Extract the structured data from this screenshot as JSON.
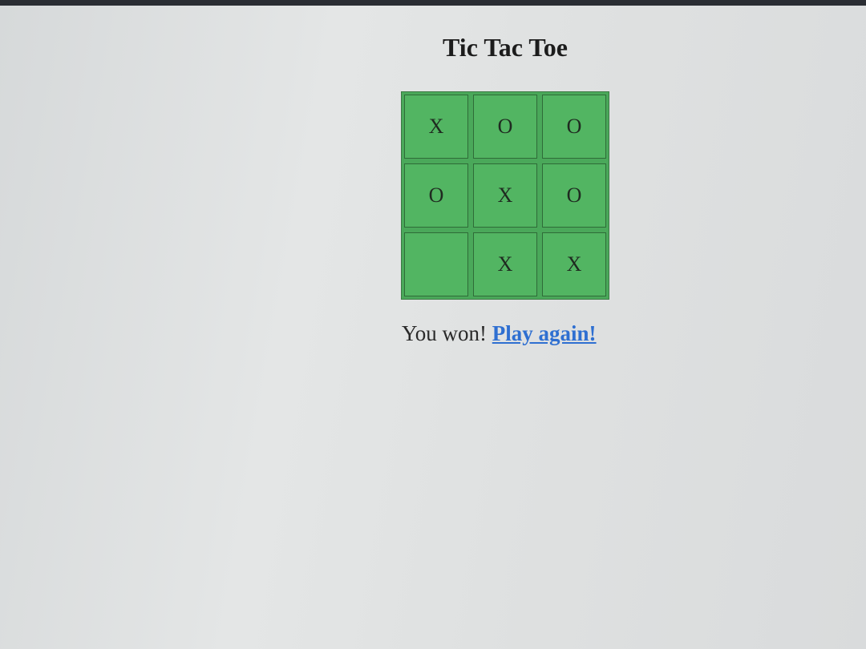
{
  "page": {
    "title": "Tic Tac Toe"
  },
  "board": {
    "cells": [
      "X",
      "O",
      "O",
      "O",
      "X",
      "O",
      "",
      "X",
      "X"
    ]
  },
  "status": {
    "message": "You won!",
    "play_again_label": "Play again!"
  },
  "colors": {
    "cell_fill": "#52b562",
    "board_fill": "#4aa85a",
    "link": "#2e6fd1"
  }
}
